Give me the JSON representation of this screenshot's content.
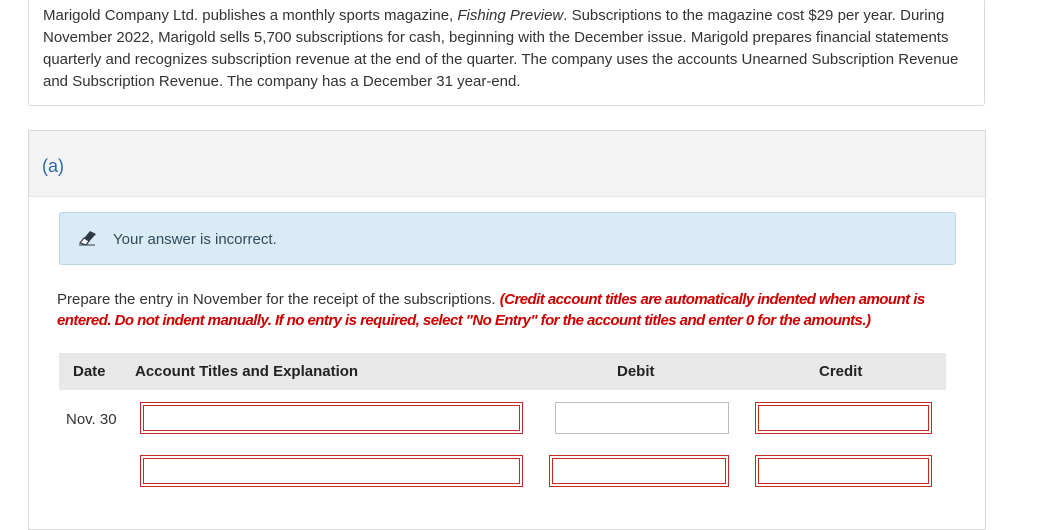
{
  "problem": {
    "text_1": "Marigold Company Ltd. publishes a monthly sports magazine, ",
    "magazine_title": "Fishing Preview",
    "text_2": ". Subscriptions to the magazine cost $29 per year. During November 2022, Marigold sells 5,700 subscriptions for cash, beginning with the December issue. Marigold prepares financial statements quarterly and recognizes subscription revenue at the end of the quarter. The company uses the accounts Unearned Subscription Revenue and Subscription Revenue. The company has a December 31 year-end."
  },
  "part": {
    "label": "(a)",
    "feedback": "Your answer is incorrect.",
    "instruction": "Prepare the entry in November for the receipt of the subscriptions. ",
    "instruction_note": "(Credit account titles are automatically indented when amount is entered. Do not indent manually. If no entry is required, select \"No Entry\" for the account titles and enter 0 for the amounts.)"
  },
  "table": {
    "headers": {
      "date": "Date",
      "account": "Account Titles and Explanation",
      "debit": "Debit",
      "credit": "Credit"
    },
    "rows": [
      {
        "date": "Nov. 30",
        "account": "",
        "debit": "",
        "credit": ""
      },
      {
        "date": "",
        "account": "",
        "debit": "",
        "credit": ""
      }
    ]
  },
  "colors": {
    "accent_blue": "#2b6aa6",
    "error_red": "#cc0000",
    "feedback_bg": "#d9ebf6"
  },
  "icons": {
    "feedback": "pencil-eraser-icon"
  }
}
